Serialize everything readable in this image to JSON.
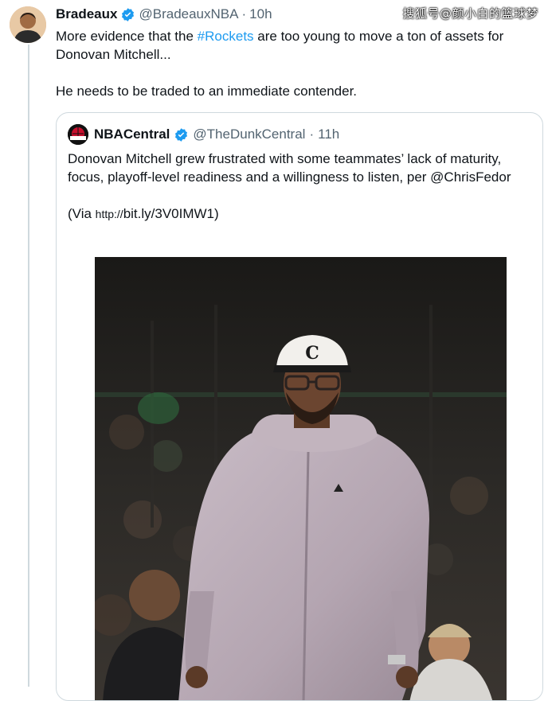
{
  "tweet": {
    "author_name": "Bradeaux",
    "handle": "@BradeauxNBA",
    "separator": "·",
    "time": "10h",
    "line1_before": "More evidence that the ",
    "hashtag": "#Rockets",
    "line1_after": " are too young to move a ton of assets for Donovan Mitchell...",
    "line2": "He needs to be traded to an immediate contender."
  },
  "quote": {
    "author_name": "NBACentral",
    "handle": "@TheDunkCentral",
    "separator": "·",
    "time": "11h",
    "text": "Donovan Mitchell grew frustrated with some teammates’ lack of maturity, focus, playoff-level readiness and a willingness to listen, per @ChrisFedor",
    "via_open": "(Via ",
    "url_protocol": "http://",
    "url_rest": "bit.ly/3V0IMW1)",
    "avatar_label": "CENTRAL"
  },
  "watermark": "搜狐号@颜小白的篮球梦",
  "colors": {
    "link": "#1d9bf0",
    "verified": "#1d9bf0",
    "secondary_text": "#536471",
    "border": "#cfd9de"
  },
  "icons": [
    "verified-badge-icon"
  ]
}
